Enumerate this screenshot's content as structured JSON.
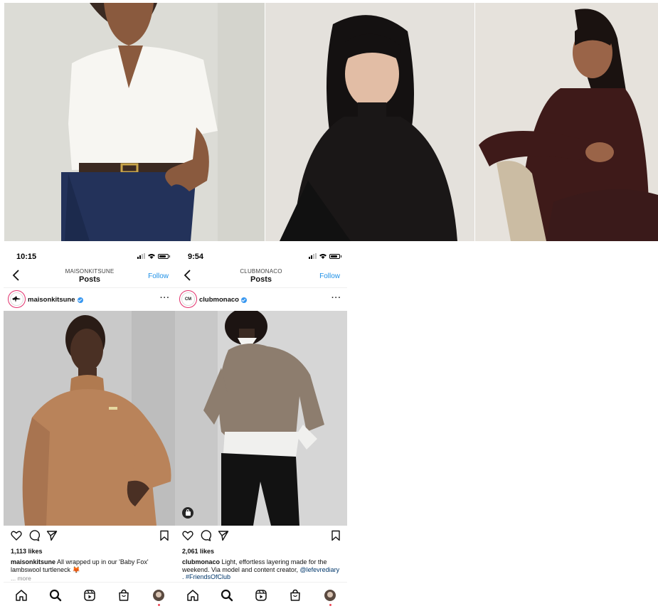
{
  "photos": [
    {
      "subject": "model in white short-sleeve shirt and blue jeans"
    },
    {
      "subject": "model in black turtleneck"
    },
    {
      "subject": "model in burgundy turtleneck seated on chair"
    }
  ],
  "posts": [
    {
      "status_time": "10:15",
      "nav_subtitle": "MAISONKITSUNE",
      "nav_title": "Posts",
      "follow_label": "Follow",
      "username": "maisonkitsune",
      "likes": "1,113 likes",
      "caption_user": "maisonkitsune",
      "caption_text": "All wrapped up in our 'Baby Fox' lambswool turtleneck 🦊",
      "more_label": "... more",
      "image_subject": "model in camel turtleneck sweater"
    },
    {
      "status_time": "9:54",
      "nav_subtitle": "CLUBMONACO",
      "nav_title": "Posts",
      "follow_label": "Follow",
      "username": "clubmonaco",
      "avatar_text": "CM",
      "likes": "2,061 likes",
      "caption_user": "clubmonaco",
      "caption_text": "Light, effortless layering made for the weekend. Via model and content creator,",
      "caption_tags": "@lefevrediary . #FriendsOfClub",
      "image_subject": "model in taupe ribbed sweater over white shirt"
    }
  ],
  "icons": {
    "back": "chevron-left-icon",
    "more": "more-horizontal-icon",
    "like": "heart-icon",
    "comment": "comment-icon",
    "share": "send-icon",
    "save": "bookmark-icon",
    "tabs": [
      "home-icon",
      "search-icon",
      "reels-icon",
      "shop-icon",
      "profile-avatar"
    ]
  },
  "colors": {
    "accent_blue": "#1e90e6",
    "verified_blue": "#3897f0",
    "story_ring": "#e1306c",
    "notification_dot": "#ed4956"
  }
}
